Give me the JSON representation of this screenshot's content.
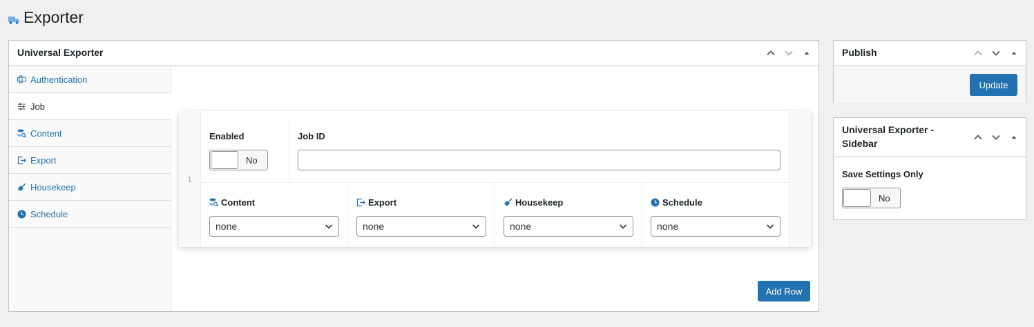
{
  "page": {
    "title": "Exporter"
  },
  "main_box": {
    "title": "Universal Exporter",
    "tabs": [
      {
        "label": "Authentication",
        "icon": "authentication-icon",
        "active": false
      },
      {
        "label": "Job",
        "icon": "sliders-icon",
        "active": true
      },
      {
        "label": "Content",
        "icon": "database-search-icon",
        "active": false
      },
      {
        "label": "Export",
        "icon": "export-icon",
        "active": false
      },
      {
        "label": "Housekeep",
        "icon": "broom-icon",
        "active": false
      },
      {
        "label": "Schedule",
        "icon": "clock-icon",
        "active": false
      }
    ],
    "row": {
      "index": "1",
      "enabled_label": "Enabled",
      "enabled_value": "No",
      "job_id_label": "Job ID",
      "job_id_value": "",
      "selects": [
        {
          "label": "Content",
          "icon": "database-search-icon",
          "value": "none"
        },
        {
          "label": "Export",
          "icon": "export-icon",
          "value": "none"
        },
        {
          "label": "Housekeep",
          "icon": "broom-icon",
          "value": "none"
        },
        {
          "label": "Schedule",
          "icon": "clock-icon",
          "value": "none"
        }
      ]
    },
    "add_row_label": "Add Row"
  },
  "publish_box": {
    "title": "Publish",
    "update_label": "Update"
  },
  "sidebar_box": {
    "title": "Universal Exporter - Sidebar",
    "save_settings_label": "Save Settings Only",
    "save_settings_value": "No"
  },
  "colors": {
    "accent": "#2271b1",
    "background": "#f0f0f1",
    "border": "#c3c4c7"
  }
}
